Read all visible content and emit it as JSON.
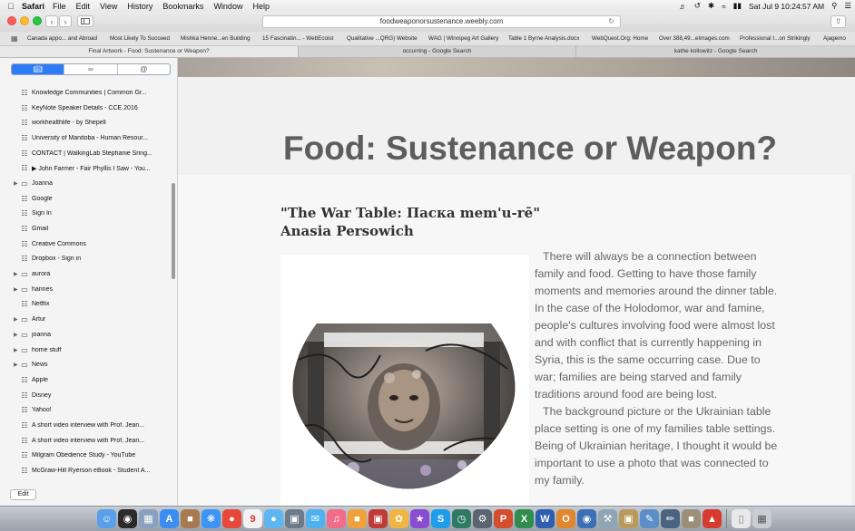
{
  "menubar": {
    "app_name": "Safari",
    "menus": [
      "File",
      "Edit",
      "View",
      "History",
      "Bookmarks",
      "Window",
      "Help"
    ],
    "clock": "Sat Jul 9  10:24:57 AM"
  },
  "toolbar": {
    "url": "foodweaponorsustenance.weebly.com"
  },
  "favorites": [
    "Canada appo... and Abroad",
    "Most Likely To Succeed",
    "Mishka Henne...en Building",
    "15 Fascinatin... - WebEcoist",
    "Qualitative ...QRG) Website",
    "WAG | Winnipeg Art Gallery",
    "Table 1 Byrne Analysis.docx",
    "WebQuest.Org: Home",
    "Over 388,49...eImages.com",
    "Professional I...on Strikingly",
    "Ajagemo"
  ],
  "tabs": [
    "Final Artwork - Food: Sustenance or Weapon?",
    "occurring - Google Search",
    "kathe kollowitz - Google Search"
  ],
  "sidebar": {
    "bookmarks": [
      {
        "label": "Knowledge Communities  |  Common Gr...",
        "type": "bookmark"
      },
      {
        "label": "KeyNote Speaker Details - CCE 2016",
        "type": "bookmark"
      },
      {
        "label": "workhealthlife - by Shepell",
        "type": "bookmark"
      },
      {
        "label": "University of Manitoba - Human Resour...",
        "type": "bookmark"
      },
      {
        "label": "CONTACT | WalkingLab Stephanie Sring...",
        "type": "bookmark"
      },
      {
        "label": "▶ John Farmer - Fair Phyllis I Saw - You...",
        "type": "bookmark"
      },
      {
        "label": "Joanna",
        "type": "folder"
      },
      {
        "label": "Google",
        "type": "bookmark"
      },
      {
        "label": "Sign In",
        "type": "bookmark"
      },
      {
        "label": "Gmail",
        "type": "bookmark"
      },
      {
        "label": "Creative Commons",
        "type": "bookmark"
      },
      {
        "label": "Dropbox - Sign in",
        "type": "bookmark"
      },
      {
        "label": "aurora",
        "type": "folder"
      },
      {
        "label": "hannes",
        "type": "folder"
      },
      {
        "label": "Netflix",
        "type": "bookmark"
      },
      {
        "label": "Artur",
        "type": "folder"
      },
      {
        "label": "joanna",
        "type": "folder"
      },
      {
        "label": "home stuff",
        "type": "folder"
      },
      {
        "label": "News",
        "type": "folder"
      },
      {
        "label": "Apple",
        "type": "bookmark"
      },
      {
        "label": "Disney",
        "type": "bookmark"
      },
      {
        "label": "Yahoo!",
        "type": "bookmark"
      },
      {
        "label": "A short video interview with Prof. Jean...",
        "type": "bookmark"
      },
      {
        "label": "A short video interview with Prof. Jean...",
        "type": "bookmark"
      },
      {
        "label": "Milgram Obedience Study - YouTube",
        "type": "bookmark"
      },
      {
        "label": "McGraw-Hill Ryerson eBook - Student A...",
        "type": "bookmark"
      }
    ],
    "edit_label": "Edit"
  },
  "page": {
    "title": "Food: Sustenance or Weapon?",
    "art_title_line1": "\"The War Table: Паска mem'u-rē\"",
    "art_title_line2": "Anasia Persowich",
    "paragraph1": "There will always be a connection between family and food. Getting to have those family moments and memories around the dinner table. In the case of the Holodomor, war and famine, people's cultures involving food were almost lost and with conflict that is currently happening in Syria, this is the same occurring case. Due to war; families are being starved and family traditions around food are being lost.",
    "paragraph2": "The background picture or the Ukrainian table place setting is one of my families table settings. Being of Ukrainian heritage, I thought it would be important to use a photo that was connected to my family."
  },
  "icons": {
    "apple": "apple-logo-icon",
    "back": "back-chevron-icon",
    "forward": "forward-chevron-icon",
    "sidebar": "sidebar-toggle-icon",
    "reload": "reload-icon",
    "share": "share-icon",
    "favorites": "grid-icon",
    "bookmark": "book-icon",
    "folder": "folder-icon"
  },
  "colors": {
    "accent": "#2d7cf6",
    "title_gray": "#5d5d5d",
    "body_gray": "#666666"
  }
}
